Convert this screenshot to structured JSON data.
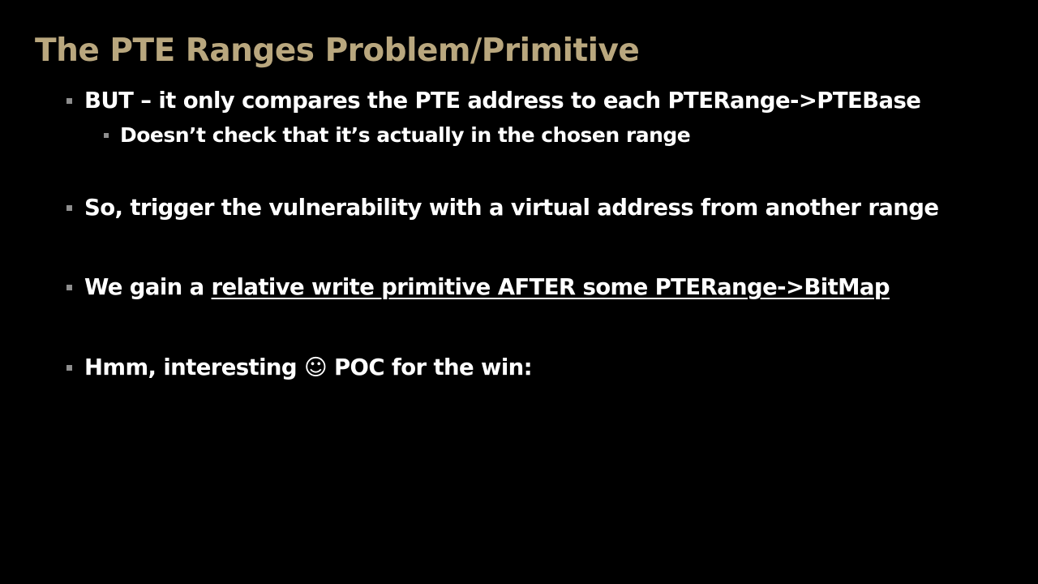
{
  "slide": {
    "title": "The PTE Ranges Problem/Primitive",
    "title_color": "#b9a77e",
    "bullets": {
      "b1": "BUT – it only compares the PTE address to each PTERange->PTEBase",
      "b1_sub": "Doesn’t check that it’s actually in the chosen range",
      "b2": "So, trigger the vulnerability with a virtual address from another range",
      "b3_prefix": "We gain a ",
      "b3_link": "relative write primitive AFTER some PTERange->BitMap",
      "b4_prefix": "Hmm, interesting ",
      "b4_emoji": "☺",
      "b4_suffix": " POC for the win:"
    }
  },
  "colors": {
    "background": "#000000",
    "text": "#ffffff",
    "bullet_marker": "#8e8e8e"
  }
}
